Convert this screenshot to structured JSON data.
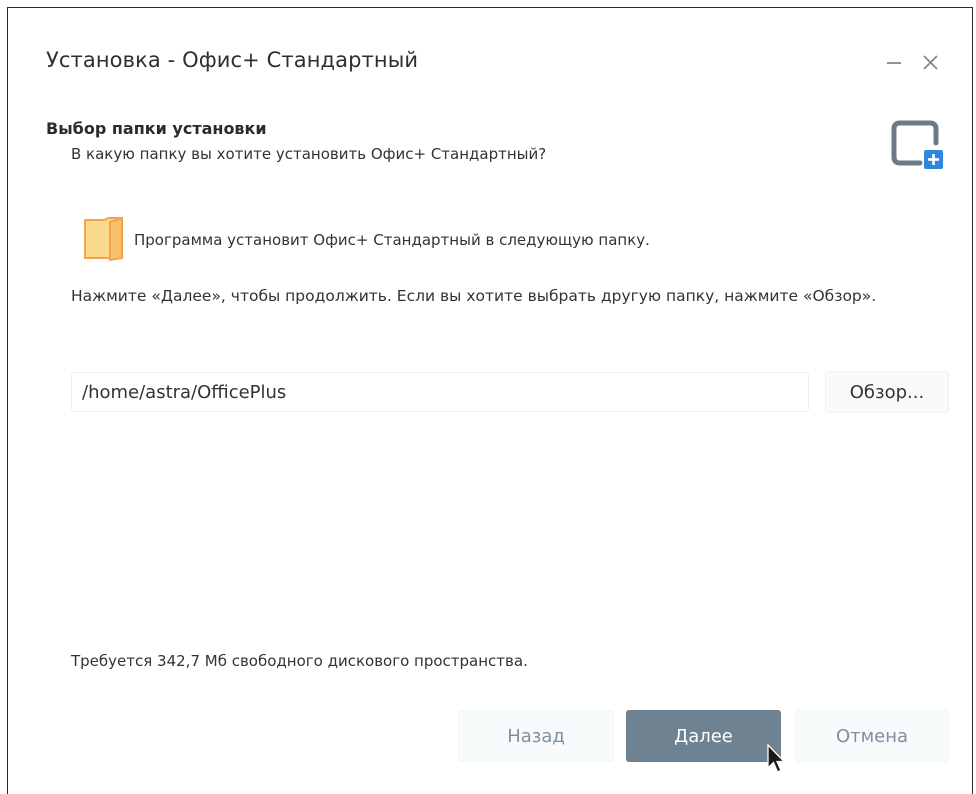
{
  "window": {
    "title": "Установка - Офис+ Стандартный"
  },
  "header": {
    "section_title": "Выбор папки установки",
    "section_subtitle": "В какую папку вы хотите установить Офис+ Стандартный?",
    "corner_icon": "install-window-plus-icon"
  },
  "body": {
    "folder_icon": "folder-icon",
    "folder_message": "Программа установит Офис+ Стандартный в следующую папку.",
    "instruction": "Нажмите «Далее», чтобы продолжить. Если вы хотите выбрать другую папку, нажмите «Обзор».",
    "path_value": "/home/astra/OfficePlus",
    "browse_label": "Обзор...",
    "space_required": "Требуется 342,7 Мб свободного дискового пространства."
  },
  "footer": {
    "back_label": "Назад",
    "next_label": "Далее",
    "cancel_label": "Отмена"
  },
  "colors": {
    "accent": "#6e8292",
    "folder": "#f7c26b",
    "icon_blue": "#2e86de",
    "icon_gray": "#6d7a86"
  }
}
